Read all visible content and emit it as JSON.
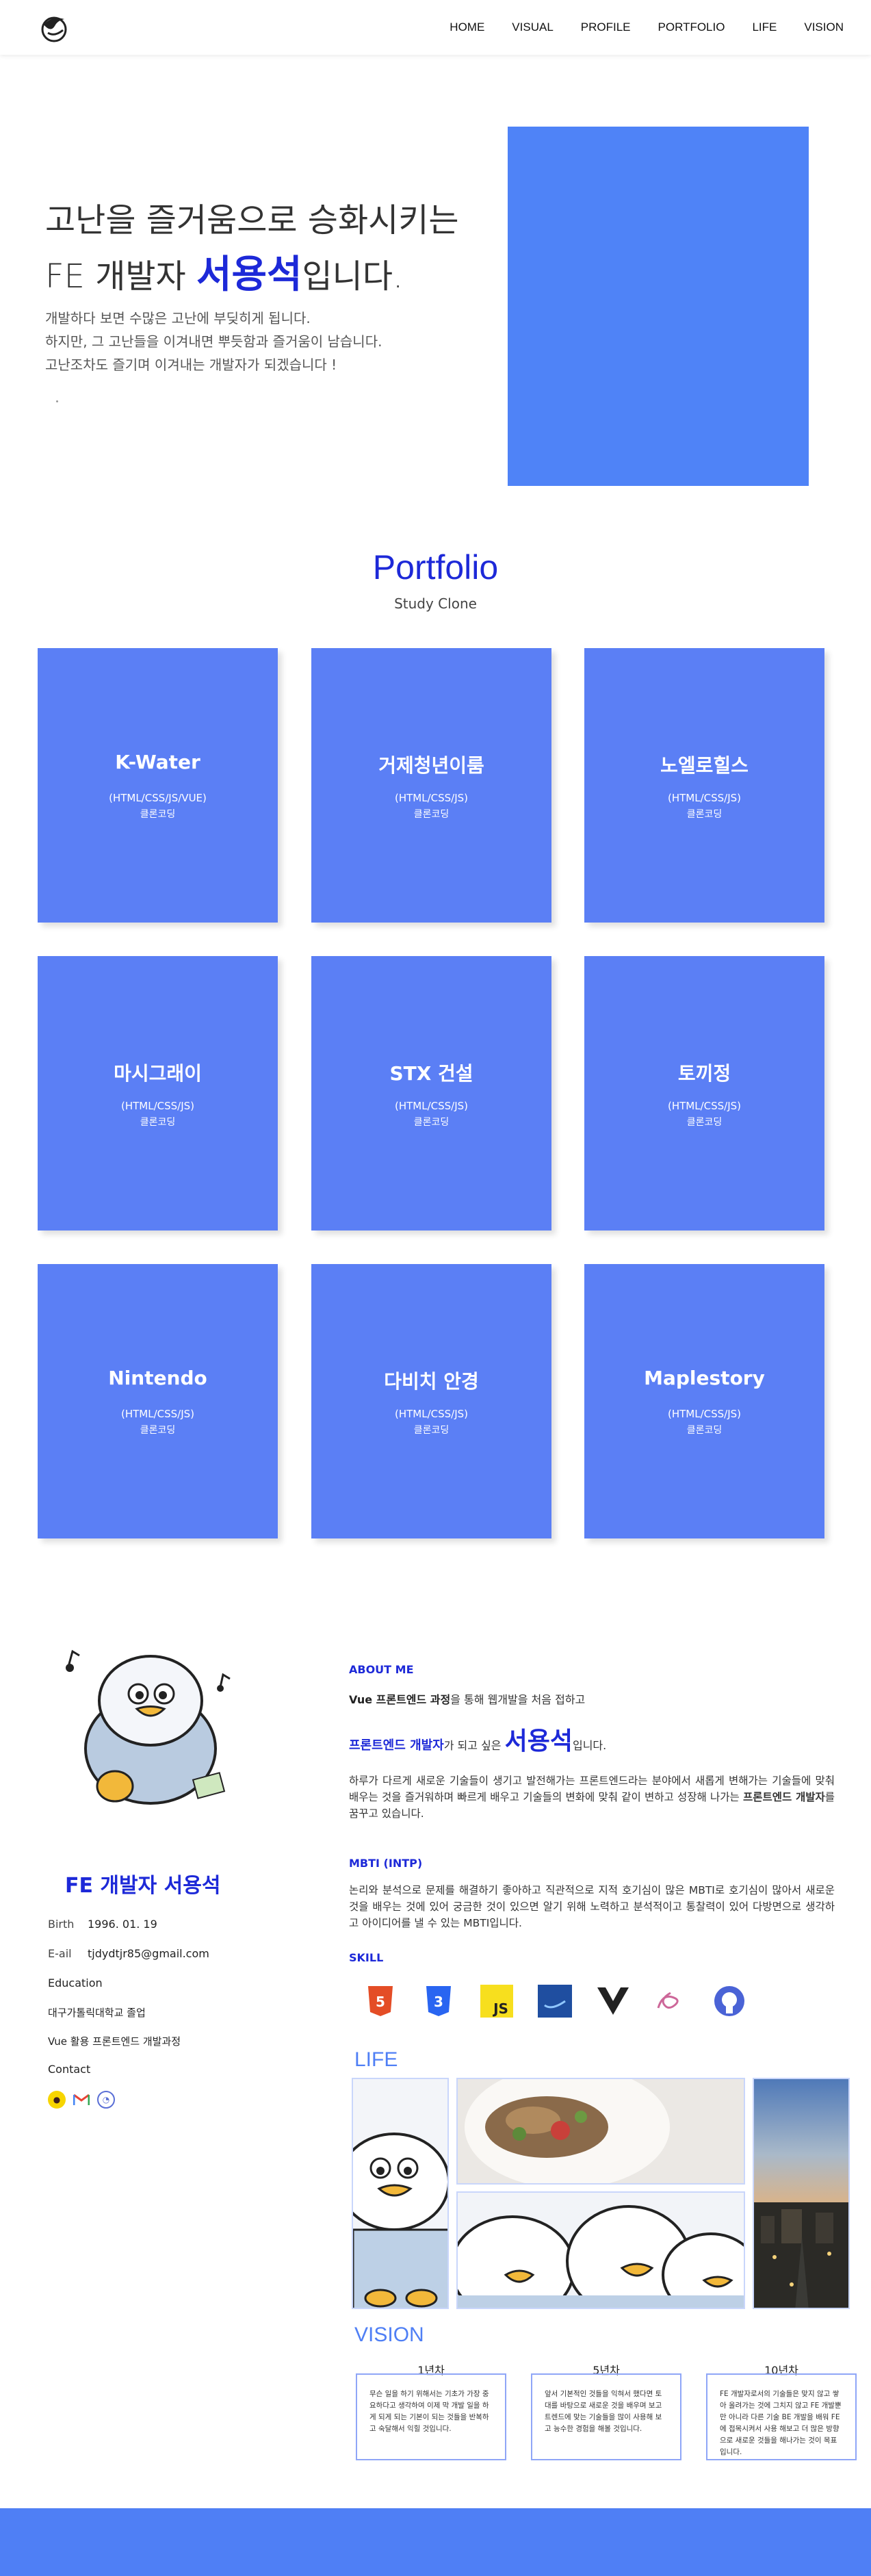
{
  "nav": {
    "logo_icon": "bird-logo-icon",
    "items": [
      "HOME",
      "VISUAL",
      "PROFILE",
      "PORTFOLIO",
      "LIFE",
      "VISION"
    ]
  },
  "hero": {
    "title_line1": "고난을 즐거움으로 승화시키는",
    "title_prefix": "FE 개발자 ",
    "title_name": "서용석",
    "title_suffix": "입니다.",
    "desc1": "개발하다 보면 수많은 고난에 부딪히게 됩니다.",
    "desc2": "하지만, 그 고난들을 이겨내면 뿌듯함과 즐거움이 남습니다.",
    "desc3": "고난조차도 즐기며 이겨내는 개발자가 되겠습니다 !",
    "box_color": "#4f83f7"
  },
  "portfolio": {
    "title": "Portfolio",
    "subtitle": "Study Clone",
    "cards": [
      {
        "title": "K-Water",
        "stack": "(HTML/CSS/JS/VUE)",
        "note": "클론코딩"
      },
      {
        "title": "거제청년이룸",
        "stack": "(HTML/CSS/JS)",
        "note": "클론코딩"
      },
      {
        "title": "노엘로힐스",
        "stack": "(HTML/CSS/JS)",
        "note": "클론코딩"
      },
      {
        "title": "마시그래이",
        "stack": "(HTML/CSS/JS)",
        "note": "클론코딩"
      },
      {
        "title": "STX 건설",
        "stack": "(HTML/CSS/JS)",
        "note": "클론코딩"
      },
      {
        "title": "토끼정",
        "stack": "(HTML/CSS/JS)",
        "note": "클론코딩"
      },
      {
        "title": "Nintendo",
        "stack": "(HTML/CSS/JS)",
        "note": "클론코딩"
      },
      {
        "title": "다비치 안경",
        "stack": "(HTML/CSS/JS)",
        "note": "클론코딩"
      },
      {
        "title": "Maplestory",
        "stack": "(HTML/CSS/JS)",
        "note": "클론코딩"
      }
    ]
  },
  "profile": {
    "name": "FE 개발자 서용석",
    "birth_label": "Birth",
    "birth": "1996. 01. 19",
    "email_label": "E-ail",
    "email": "tjdydtjr85@gmail.com",
    "education_label": "Education",
    "edu1": "대구가톨릭대학교 졸업",
    "edu2": "Vue 활용 프론트엔드 개발과정",
    "contact_label": "Contact",
    "contacts": [
      "kakaotalk-icon",
      "gmail-icon",
      "github-icon"
    ]
  },
  "about": {
    "heading": "ABOUT ME",
    "line1_bold": "Vue 프론트엔드 과정",
    "line1_rest": "을 통해 웹개발을 처음 접하고",
    "line2_bold": "프론트엔드 개발자",
    "line2_mid": "가 되고 싶은 ",
    "line2_name": "서용석",
    "line2_end": "입니다.",
    "para_a": "하루가 다르게 새로운 기술들이 생기고 발전해가는 프론트엔드라는 분야에서 새롭게 변해가는 기술들에 맞춰 배우는 것을 즐거워하며 빠르게 배우고 기술들의 변화에 맞춰 같이 변하고 성장해 나가는 ",
    "para_b": "프론트엔드 개발자",
    "para_c": "를 꿈꾸고 있습니다.",
    "mbti_heading": "MBTI (INTP)",
    "mbti_text": "논리와 분석으로 문제를 해결하기 좋아하고 직관적으로 지적 호기심이 많은 MBTI로 호기심이 많아서 새로운 것을 배우는 것에 있어 궁금한 것이 있으면 알기 위해 노력하고 분석적이고 통찰력이 있어 다방면으로 생각하고 아이디어를 낼 수 있는 MBTI입니다.",
    "skill_heading": "SKILL",
    "skills": [
      "html5-icon",
      "css3-icon",
      "javascript-icon",
      "jquery-icon",
      "vue-icon",
      "sass-icon",
      "github-icon"
    ]
  },
  "life": {
    "heading": "LIFE"
  },
  "vision": {
    "heading": "VISION",
    "items": [
      {
        "year": "1년차",
        "text": "무슨 일을 하기 위해서는 기초가 가장 중요하다고 생각하여 이제 막 개발 일을 하게 되게 되는 기본이 되는 것들을 반복하고 숙달해서 익힐 것입니다."
      },
      {
        "year": "5년차",
        "text": "앞서 기본적인 것들을 익혀서 했다면 토대를 바탕으로 새로운 것을 배우며 보고 트렌드에 맞는 기술들을 많이 사용해 보고 능수한 경험을 해볼 것입니다."
      },
      {
        "year": "10년차",
        "text": "FE 개발자로서의 기술들은 맞지 않고 쌓아 올려가는 것에 그치지 않고 FE 개발뿐만 아니라 다른 기술 BE 개발을 배워 FE에 접목시켜서 사용 해보고 더 많은 방향으로 새로운 것들을 해나가는 것이 목표입니다."
      }
    ]
  }
}
